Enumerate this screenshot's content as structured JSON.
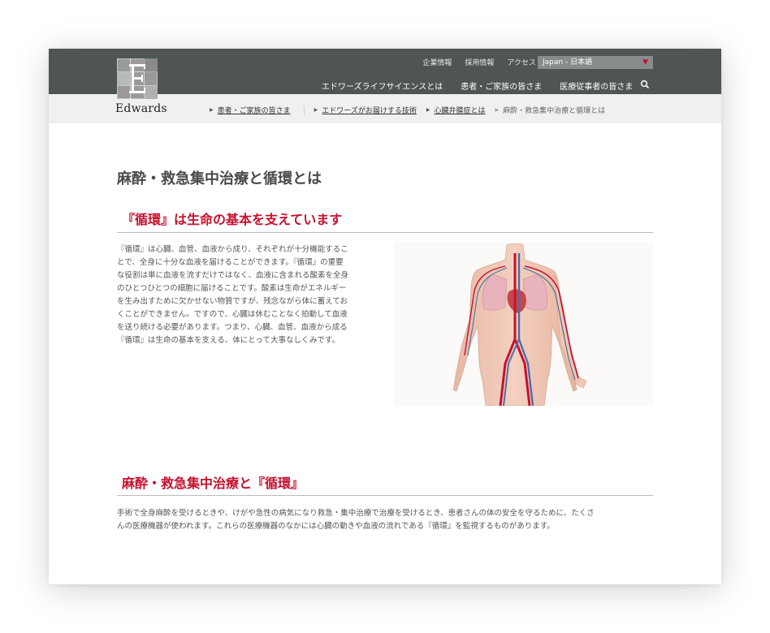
{
  "logo": {
    "text": "Edwards"
  },
  "util_nav": [
    "企業情報",
    "採用情報",
    "アクセス"
  ],
  "language": {
    "selected": "Japan - 日本語"
  },
  "main_nav": [
    "エドワーズライフサイエンスとは",
    "患者・ご家族の皆さま",
    "医療従事者の皆さま"
  ],
  "breadcrumb": [
    "患者・ご家族の皆さま",
    "エドワーズがお届けする技術",
    "心臓弁膜症とは",
    "麻酔・救急集中治療と循環とは"
  ],
  "page_title": "麻酔・救急集中治療と循環とは",
  "section1": {
    "title": "『循環』は生命の基本を支えています",
    "lines": [
      "『循環』は心臓、血管、血液から成り、それぞれが十分機能するこ",
      "とで、全身に十分な血液を届けることができます。『循環』の重要",
      "な役割は単に血液を流すだけではなく、血液に含まれる酸素を全身",
      "のひとつひとつの細胞に届けることです。酸素は生命がエネルギー",
      "を生み出すために欠かせない物質ですが、残念ながら体に蓄えてお",
      "くことができません。ですので、心臓は休むことなく拍動して血液",
      "を送り続ける必要があります。つまり、心臓、血管、血液から成る",
      "『循環』は生命の基本を支える、体にとって大事なしくみです。"
    ]
  },
  "section2": {
    "title": "麻酔・救急集中治療と『循環』",
    "lines": [
      "手術で全身麻酔を受けるときや、けがや急性の病気になり救急・集中治療で治療を受けるとき、患者さんの体の安全を守るために、たくさ",
      "んの医療機器が使われます。これらの医療機器のなかには心臓の動きや血液の流れである『循環』を監視するものがあります。"
    ]
  },
  "colors": {
    "header_bg": "#4f5454",
    "accent_red": "#c8102e",
    "breadcrumb_bg": "#f0f0f0"
  },
  "icons": {
    "search": "search-icon",
    "dropdown": "chevron-down-icon"
  }
}
